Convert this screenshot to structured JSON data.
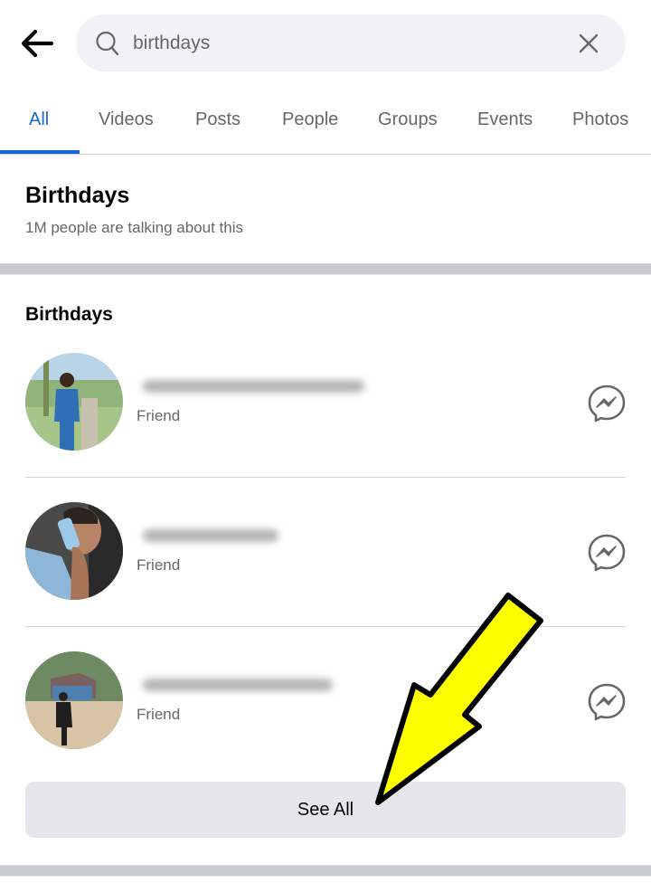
{
  "header": {
    "back_icon": "arrow-left-icon",
    "search": {
      "icon": "search-icon",
      "value": "birthdays",
      "clear_icon": "close-icon"
    }
  },
  "tabs": [
    {
      "label": "All",
      "active": true
    },
    {
      "label": "Videos",
      "active": false
    },
    {
      "label": "Posts",
      "active": false
    },
    {
      "label": "People",
      "active": false
    },
    {
      "label": "Groups",
      "active": false
    },
    {
      "label": "Events",
      "active": false
    },
    {
      "label": "Photos",
      "active": false
    }
  ],
  "topic": {
    "title": "Birthdays",
    "subtitle": "1M people are talking about this"
  },
  "birthdays_section": {
    "title": "Birthdays",
    "people": [
      {
        "name": "[blurred]",
        "relation": "Friend",
        "action_icon": "messenger-icon"
      },
      {
        "name": "[blurred]",
        "relation": "Friend",
        "action_icon": "messenger-icon"
      },
      {
        "name": "[blurred]",
        "relation": "Friend",
        "action_icon": "messenger-icon"
      }
    ],
    "see_all_label": "See All"
  },
  "annotation": {
    "type": "arrow",
    "points_to": "See All",
    "fill_color": "#ffff00",
    "stroke_color": "#000000"
  },
  "colors": {
    "accent": "#1766d6",
    "secondary_text": "#65676b",
    "search_bg": "#f0f2f5",
    "button_bg": "#e4e6eb",
    "band": "#c8ccd1"
  }
}
